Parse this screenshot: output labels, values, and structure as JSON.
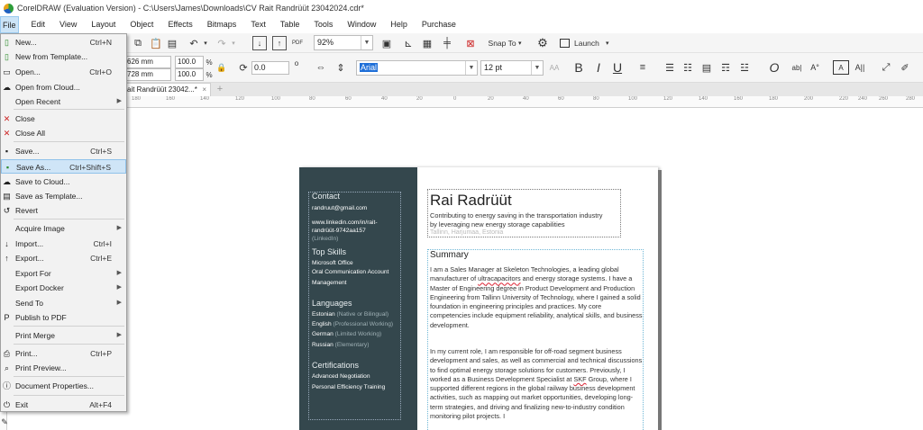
{
  "window": {
    "title": "CorelDRAW (Evaluation Version) - C:\\Users\\James\\Downloads\\CV Rait Randrüüt 23042024.cdr*"
  },
  "menu": [
    "File",
    "Edit",
    "View",
    "Layout",
    "Object",
    "Effects",
    "Bitmaps",
    "Text",
    "Table",
    "Tools",
    "Window",
    "Help",
    "Purchase"
  ],
  "toolbar": {
    "zoom": "92%",
    "snap_to": "Snap To",
    "launch": "Launch",
    "size_w": "626 mm",
    "size_h": "728 mm",
    "scale_w": "100.0",
    "scale_h": "100.0",
    "pct": "%",
    "rotation": "0.0",
    "deg": "o",
    "font": "Arial",
    "font_size": "12 pt",
    "bold": "B",
    "italic": "I",
    "underline": "U"
  },
  "tab": {
    "label": "ait Randrüüt 23042...*",
    "close": "×",
    "add": "+"
  },
  "ruler": [
    "180",
    "160",
    "140",
    "120",
    "100",
    "80",
    "60",
    "40",
    "20",
    "0",
    "20",
    "40",
    "60",
    "80",
    "100",
    "120",
    "140",
    "160",
    "180",
    "200",
    "220",
    "240",
    "260",
    "280"
  ],
  "file_menu": [
    {
      "label": "New...",
      "shortcut": "Ctrl+N",
      "icon": "new-doc-icon"
    },
    {
      "label": "New from Template...",
      "icon": "template-icon"
    },
    {
      "label": "Open...",
      "shortcut": "Ctrl+O",
      "icon": "open-folder-icon"
    },
    {
      "label": "Open from Cloud...",
      "icon": "cloud-open-icon"
    },
    {
      "label": "Open Recent",
      "submenu": true
    },
    {
      "label": "Close",
      "icon": "close-doc-icon"
    },
    {
      "label": "Close All",
      "icon": "close-all-icon"
    },
    {
      "label": "Save...",
      "shortcut": "Ctrl+S",
      "icon": "save-icon"
    },
    {
      "label": "Save As...",
      "shortcut": "Ctrl+Shift+S",
      "icon": "save-as-icon",
      "highlighted": true
    },
    {
      "label": "Save to Cloud...",
      "icon": "cloud-save-icon"
    },
    {
      "label": "Save as Template...",
      "icon": "save-template-icon"
    },
    {
      "label": "Revert",
      "icon": "revert-icon"
    },
    {
      "label": "Acquire Image",
      "submenu": true
    },
    {
      "label": "Import...",
      "shortcut": "Ctrl+I",
      "icon": "import-icon"
    },
    {
      "label": "Export...",
      "shortcut": "Ctrl+E",
      "icon": "export-icon"
    },
    {
      "label": "Export For",
      "submenu": true
    },
    {
      "label": "Export Docker",
      "submenu": true
    },
    {
      "label": "Send To",
      "submenu": true
    },
    {
      "label": "Publish to PDF",
      "icon": "pdf-icon"
    },
    {
      "label": "Print Merge",
      "submenu": true
    },
    {
      "label": "Print...",
      "shortcut": "Ctrl+P",
      "icon": "print-icon"
    },
    {
      "label": "Print Preview...",
      "icon": "print-preview-icon"
    },
    {
      "label": "Document Properties...",
      "icon": "properties-icon"
    },
    {
      "label": "Exit",
      "shortcut": "Alt+F4",
      "icon": "exit-icon"
    }
  ],
  "cv": {
    "contact_h": "Contact",
    "email": "randruut@gmail.com",
    "linkedin_1": "www.linkedin.com/in/rait-",
    "linkedin_2": "randrüüt-9742aa157",
    "linkedin_3": "(LinkedIn)",
    "skills_h": "Top Skills",
    "skill_1": "Microsoft Office",
    "skill_2": "Oral Communication Account",
    "skill_3": "Management",
    "lang_h": "Languages",
    "lang_1": "Estonian",
    "lang_1_lvl": "(Native or Bilingual)",
    "lang_2": "English",
    "lang_2_lvl": "(Professional Working)",
    "lang_3": "German",
    "lang_3_lvl": "(Limited Working)",
    "lang_4": "Russian",
    "lang_4_lvl": "(Elementary)",
    "cert_h": "Certifications",
    "cert_1": "Advanced Negotiation",
    "cert_2": "Personal Efficiency Training",
    "name": "Rai Radrüüt",
    "tagline_1": "Contributing to energy saving in the transportation industry",
    "tagline_2": "by leveraging new energy storage capabilities",
    "location": "Tallinn, Harjumaa, Estonia",
    "summary_h": "Summary",
    "para1_a": "I am a Sales Manager at Skeleton Technologies, a leading global manufacturer of ",
    "para1_ul": "ultracapacitors",
    "para1_b": " and energy storage systems. I have a Master of Engineering degree in Product Development and Production Engineering from Tallinn University of Technology, where I gained a solid foundation in engineering principles and practices. My core competencies include equipment reliability, analytical skills, and business development.",
    "para2_a": "In my current role, I am responsible for off-road segment business development and sales, as well as commercial and technical discussions to find optimal energy storage solutions for customers. Previously, I worked as a Business Development Specialist at ",
    "para2_ul": "SKF",
    "para2_b": " Group, where I supported different regions in the global railway business development activities, such as mapping out market opportunities, developing long-term strategies, and driving and finalizing new-to-industry condition monitoring pilot projects. I"
  }
}
